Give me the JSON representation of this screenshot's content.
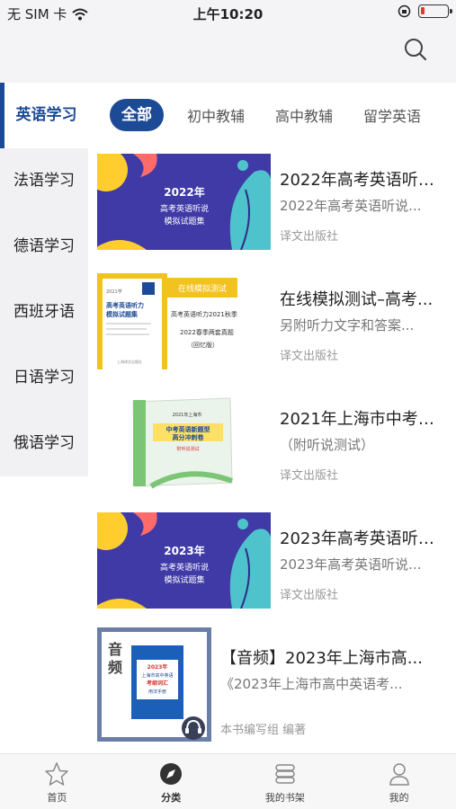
{
  "status": {
    "carrier": "无 SIM 卡",
    "time": "上午10:20",
    "battery_level": 0.15
  },
  "sidebar": {
    "items": [
      {
        "label": "英语学习",
        "active": true
      },
      {
        "label": "法语学习"
      },
      {
        "label": "德语学习"
      },
      {
        "label": "西班牙语"
      },
      {
        "label": "日语学习"
      },
      {
        "label": "俄语学习"
      }
    ]
  },
  "tabs": [
    {
      "label": "全部",
      "active": true
    },
    {
      "label": "初中教辅"
    },
    {
      "label": "高中教辅"
    },
    {
      "label": "留学英语"
    }
  ],
  "books": [
    {
      "title": "2022年高考英语听说...",
      "subtitle": "2022年高考英语听说...",
      "publisher": "译文出版社",
      "cover": {
        "year": "2022年",
        "line1": "高考英语听说",
        "line2": "模拟试题集"
      }
    },
    {
      "title": "在线模拟测试–高考...",
      "subtitle": "另附听力文字和答案...",
      "publisher": "译文出版社",
      "cover": {
        "banner": "在线模拟测试",
        "side1": "高考英语听力2021秋季",
        "side2": "2022春季两套真题",
        "side3": "（回忆版）",
        "book_year": "2021学",
        "book_title1": "高考英语听力",
        "book_title2": "模拟试题集",
        "book_sub": "上海译文出版社"
      }
    },
    {
      "title": "2021年上海市中考英...",
      "subtitle": "（附听说测试）",
      "publisher": "译文出版社",
      "cover": {
        "top": "2021年上海市",
        "title1": "中考英语新题型",
        "title2": "高分冲刺卷",
        "tag": "附听说测试"
      }
    },
    {
      "title": "2023年高考英语听说...",
      "subtitle": "2023年高考英语听说...",
      "publisher": "译文出版社",
      "cover": {
        "year": "2023年",
        "line1": "高考英语听说",
        "line2": "模拟试题集"
      }
    },
    {
      "title": "【音频】2023年上海市高...",
      "subtitle": "《2023年上海市高中英语考...",
      "publisher": "本书编写组 编著",
      "cover": {
        "label1": "音",
        "label2": "频",
        "book_year": "2023年",
        "book_title1": "上海市高中英语",
        "book_title2": "考纲词汇",
        "book_title3": "用法手册"
      }
    }
  ],
  "bottom_nav": [
    {
      "label": "首页",
      "icon": "star-icon"
    },
    {
      "label": "分类",
      "icon": "compass-icon",
      "active": true
    },
    {
      "label": "我的书架",
      "icon": "bookshelf-icon"
    },
    {
      "label": "我的",
      "icon": "person-icon"
    }
  ],
  "colors": {
    "accent": "#1c4a96",
    "purple": "#3f3aa6",
    "yellow": "#ffce2e",
    "teal": "#4fc3cc",
    "pink": "#ff6b6b"
  }
}
